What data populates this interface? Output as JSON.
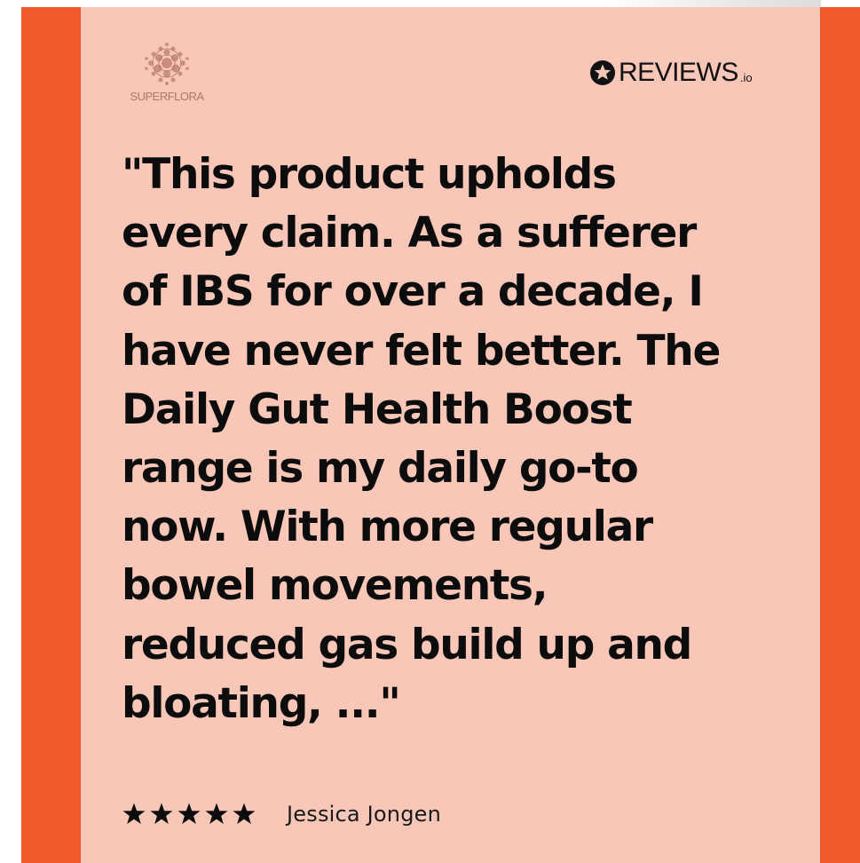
{
  "brand": {
    "logo_text": "SUPERFLORA",
    "logo_icon": "bubble-cluster-logo-icon",
    "logo_color": "#b27766"
  },
  "platform": {
    "name": "REVIEWS",
    "suffix": ".io",
    "icon": "star-badge-icon"
  },
  "review": {
    "quote": "\"This product upholds\nevery claim. As a sufferer\nof IBS for over a decade, I\nhave never felt better. The\nDaily Gut Health Boost\nrange is my daily go-to\nnow. With more regular\nbowel movements,\nreduced gas build up and\nbloating, ...\"",
    "rating": 5,
    "rating_max": 5,
    "reviewer": "Jessica Jongen"
  },
  "colors": {
    "frame": "#f05a2a",
    "card": "#f9c7b8",
    "text": "#0c0c0c"
  }
}
